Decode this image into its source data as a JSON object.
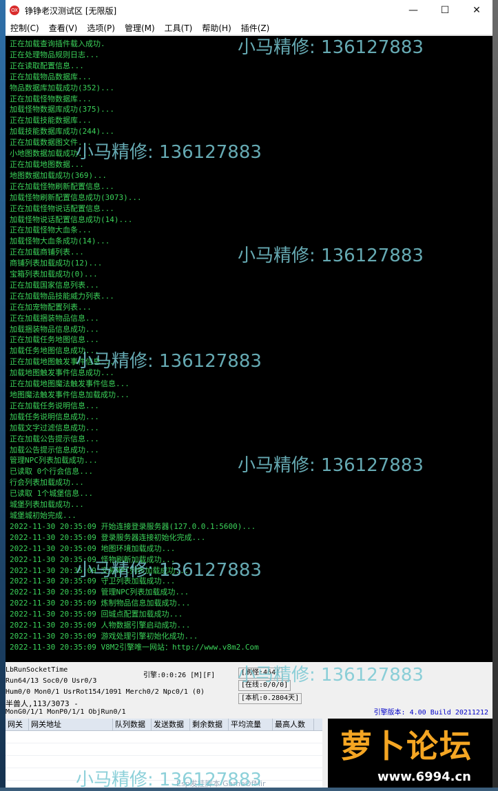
{
  "window": {
    "title": "铮铮老汉测试区 [无限版]",
    "icon_label": "OX"
  },
  "menu": [
    "控制(C)",
    "查看(V)",
    "选项(P)",
    "管理(M)",
    "工具(T)",
    "帮助(H)",
    "插件(Z)"
  ],
  "log_lines": [
    "正在加载查询插件载入成功.",
    "正在处理物品规则日志...",
    "正在读取配置信息...",
    "正在加载物品数据库...",
    "物品数据库加载成功(352)...",
    "正在加载怪物数据库...",
    "加载怪物数据库成功(375)...",
    "正在加载技能数据库...",
    "加载技能数据库成功(244)...",
    "正在加载数据图文件...",
    "小地图数据加载成功...",
    "正在加载地图数据...",
    "地图数据加载成功(369)...",
    "正在加载怪物刷新配置信息...",
    "加载怪物刷新配置信息成功(3073)...",
    "正在加载怪物说话配置信息...",
    "加载怪物说话配置信息成功(14)...",
    "正在加载怪物大血条...",
    "加载怪物大血条成功(14)...",
    "正在加载商铺列表...",
    "商铺列表加载成功(12)...",
    "宝箱列表加载成功(0)...",
    "正在加载国家信息列表...",
    "正在加载物品技能威力列表...",
    "正在加宠物配置列表...",
    "正在加载捆装物品信息...",
    "加载捆装物品信息成功...",
    "正在加载任务地图信息...",
    "加载任务地图信息成功...",
    "正在加载地图触发事件信息...",
    "加载地图触发事件信息成功...",
    "正在加载地图魔法触发事件信息...",
    "地图魔法触发事件信息加载成功...",
    "正在加载任务说明信息...",
    "加载任务说明信息成功...",
    "加载文字过滤信息成功...",
    "正在加载公告提示信息...",
    "加载公告提示信息成功...",
    "管理NPC列表加载成功...",
    "已读取 0个行会信息...",
    "行会列表加载成功...",
    "已读取 1个城堡信息...",
    "城堡列表加载成功...",
    "城堡城初始完成...",
    "2022-11-30 20:35:09 开始连接登录服务器(127.0.0.1:5600)...",
    "2022-11-30 20:35:09 登录服务器连接初始化完成...",
    "2022-11-30 20:35:09 地图环境加载成功...",
    "2022-11-30 20:35:09 怪物刷新加载成功...",
    "2022-11-30 20:35:09 交易NPC列表加载成功...",
    "2022-11-30 20:35:09 守卫列表加载成功...",
    "2022-11-30 20:35:09 管理NPC列表加载成功...",
    "2022-11-30 20:35:09 炼制物品信息加载成功...",
    "2022-11-30 20:35:09 回城点配置加载成功...",
    "2022-11-30 20:35:09 人物数据引擎启动成功...",
    "2022-11-30 20:35:09 游戏处理引擎初始化成功...",
    "2022-11-30 20:35:09 V8M2引擎唯一网站：http://www.v8m2.Com"
  ],
  "status": {
    "socket": "LbRunSocketTime",
    "run": "Run64/13 Soc0/0 Usr0/3",
    "engine": "引擎:0:0:26 [M][F]",
    "refresh": "[刷怪:464]",
    "online": "[在线:0/0/0]",
    "hum": "Hum0/0 Mon0/1 UsrRot154/1091 Merch0/2 Npc0/1 (0)",
    "local": "[本机:0.2804天]",
    "monster": "半兽人,113/3073 -",
    "mongen": "MonG0/1/1 MonP0/1/1 ObjRun0/1",
    "version": "引擎版本: 4.00 Build 20211212"
  },
  "gateway_columns": [
    "网关",
    "网关地址",
    "队列数据",
    "发送数据",
    "剩余数据",
    "平均流量",
    "最高人数"
  ],
  "taskbar_text": "Esp发挂脚本  GameOfMir",
  "logo": {
    "text": "萝卜论坛",
    "url": "www.6994.cn"
  },
  "watermark": "小马精修: 136127883",
  "colors": {
    "log_text": "#3bd35a",
    "log_bg": "#000000",
    "version_text": "#0000c8",
    "logo_orange": "#f5a623"
  }
}
